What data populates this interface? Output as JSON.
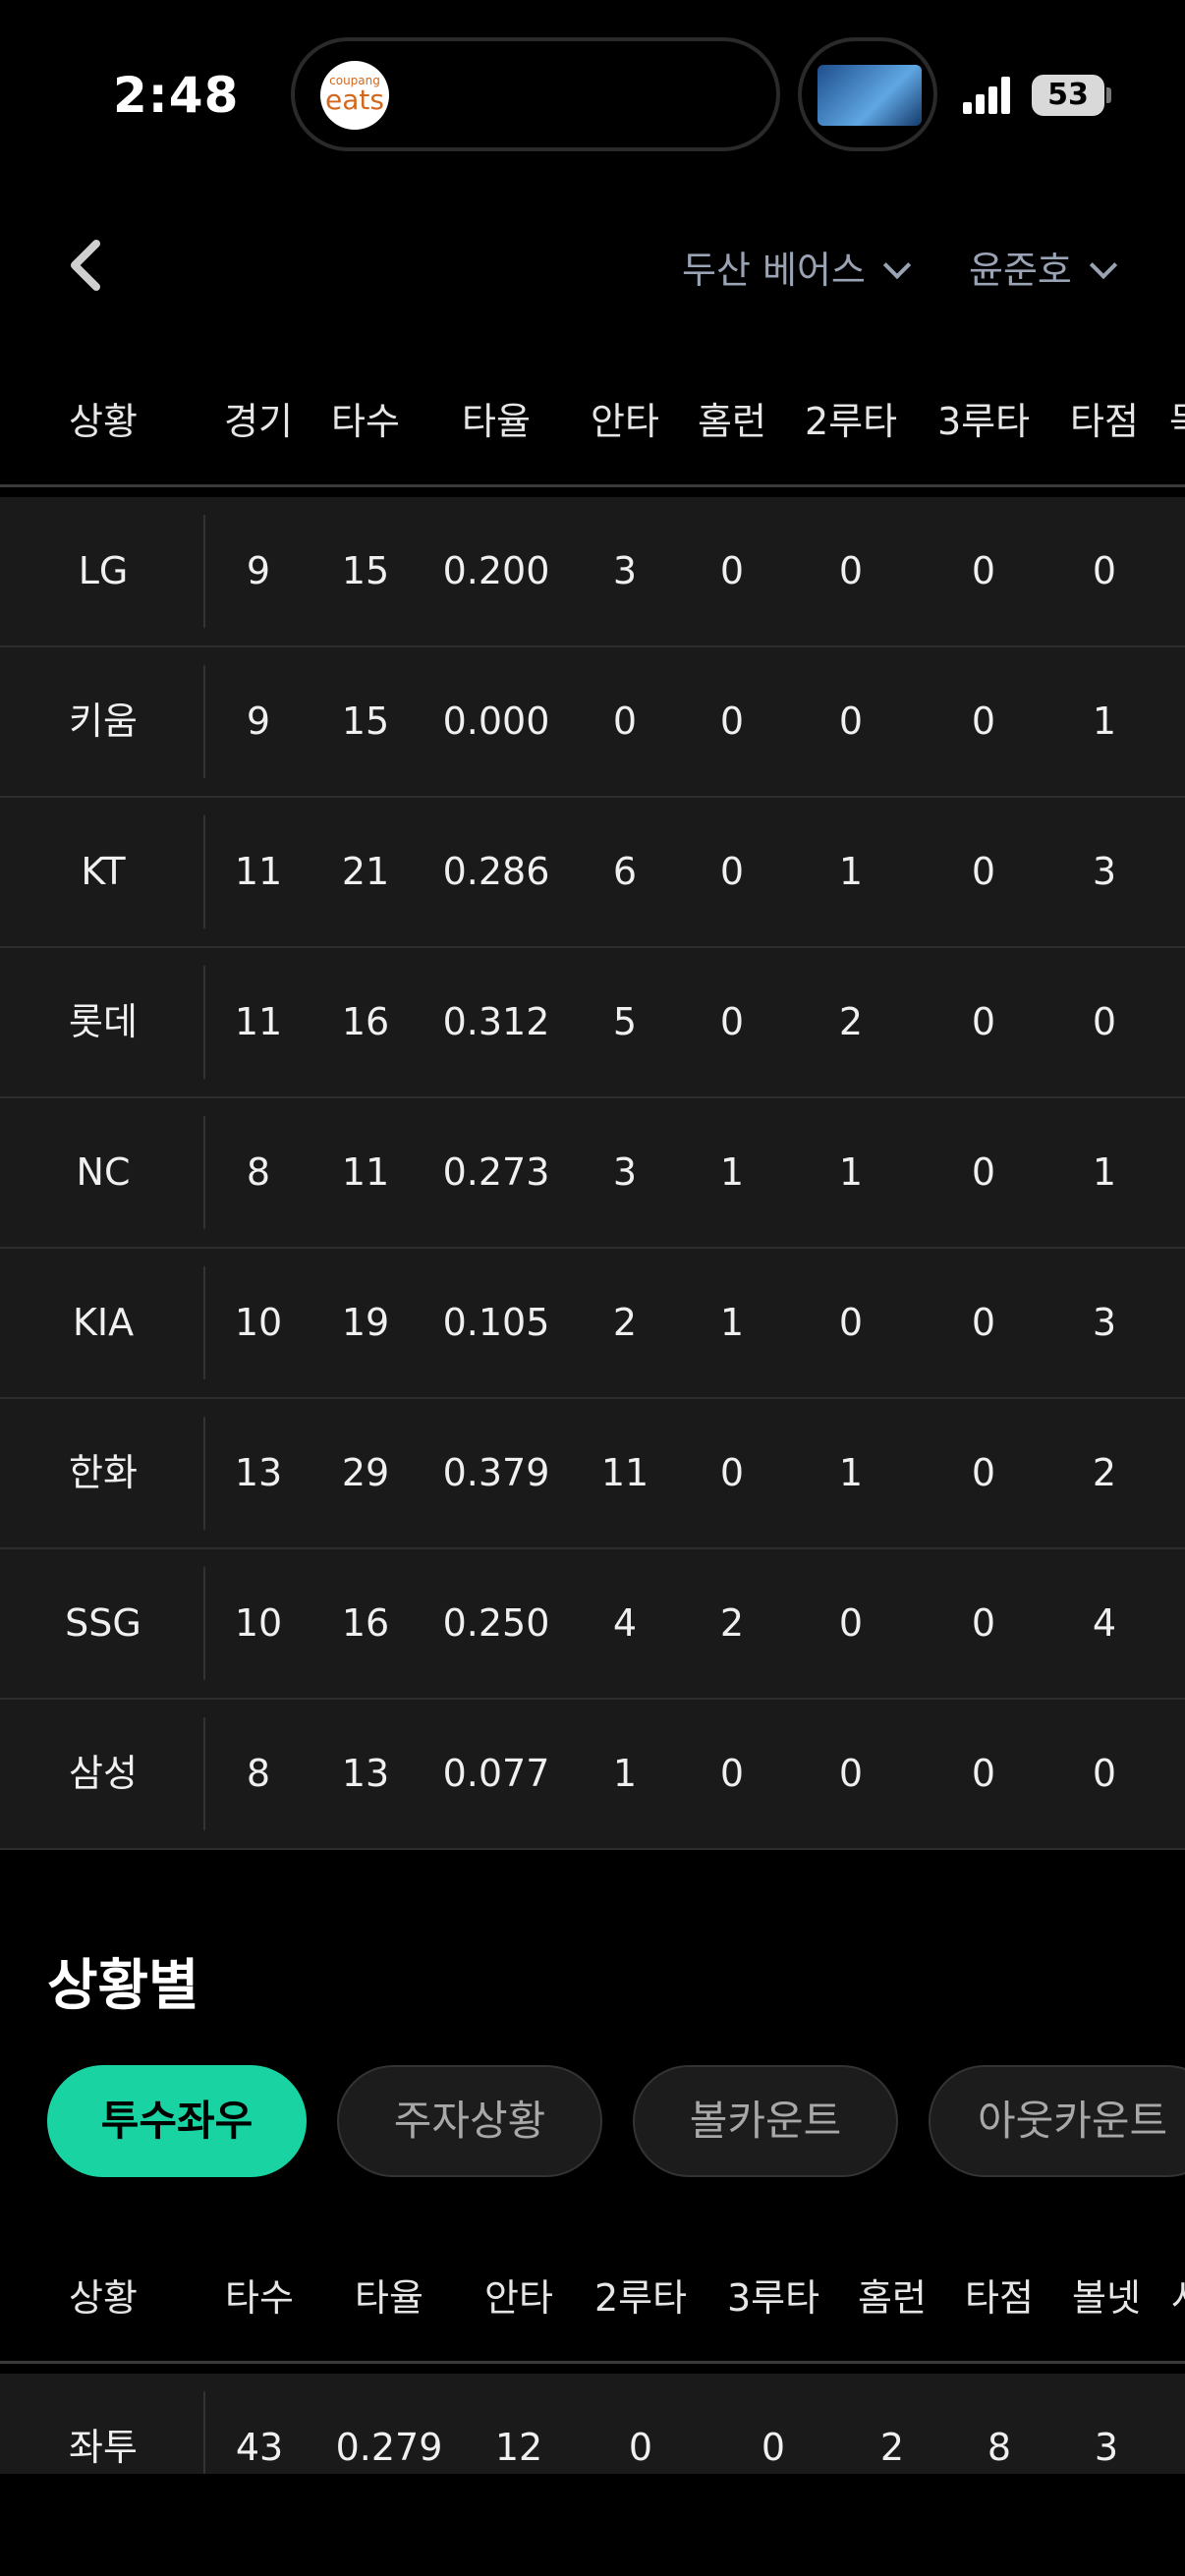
{
  "status_bar": {
    "time": "2:48",
    "app_icon_top": "coupang",
    "app_icon_bottom": "eats",
    "battery": "53"
  },
  "nav": {
    "team": "두산 베어스",
    "player": "윤준호"
  },
  "table1": {
    "headers": [
      "상황",
      "경기",
      "타수",
      "타율",
      "안타",
      "홈런",
      "2루타",
      "3루타",
      "타점",
      "득"
    ],
    "rows": [
      [
        "LG",
        "9",
        "15",
        "0.200",
        "3",
        "0",
        "0",
        "0",
        "0"
      ],
      [
        "키움",
        "9",
        "15",
        "0.000",
        "0",
        "0",
        "0",
        "0",
        "1"
      ],
      [
        "KT",
        "11",
        "21",
        "0.286",
        "6",
        "0",
        "1",
        "0",
        "3"
      ],
      [
        "롯데",
        "11",
        "16",
        "0.312",
        "5",
        "0",
        "2",
        "0",
        "0"
      ],
      [
        "NC",
        "8",
        "11",
        "0.273",
        "3",
        "1",
        "1",
        "0",
        "1"
      ],
      [
        "KIA",
        "10",
        "19",
        "0.105",
        "2",
        "1",
        "0",
        "0",
        "3"
      ],
      [
        "한화",
        "13",
        "29",
        "0.379",
        "11",
        "0",
        "1",
        "0",
        "2"
      ],
      [
        "SSG",
        "10",
        "16",
        "0.250",
        "4",
        "2",
        "0",
        "0",
        "4"
      ],
      [
        "삼성",
        "8",
        "13",
        "0.077",
        "1",
        "0",
        "0",
        "0",
        "0"
      ]
    ]
  },
  "situation": {
    "title": "상황별",
    "chips": [
      "투수좌우",
      "주자상황",
      "볼카운트",
      "아웃카운트"
    ],
    "headers": [
      "상황",
      "타수",
      "타율",
      "안타",
      "2루타",
      "3루타",
      "홈런",
      "타점",
      "볼넷",
      "사"
    ],
    "rows": [
      [
        "좌투",
        "43",
        "0.279",
        "12",
        "0",
        "0",
        "2",
        "8",
        "3"
      ]
    ]
  }
}
